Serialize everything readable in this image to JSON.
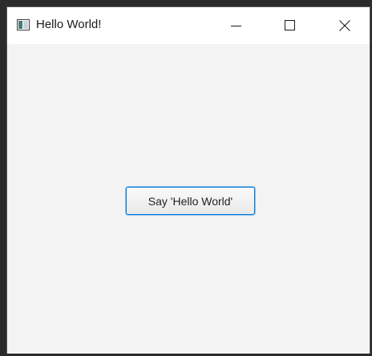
{
  "window": {
    "title": "Hello World!",
    "icon": "java-window-icon",
    "controls": [
      "minimize-icon",
      "maximize-icon",
      "close-icon"
    ]
  },
  "main": {
    "button_label": "Say 'Hello World'"
  },
  "colors": {
    "titlebar_bg": "#ffffff",
    "content_bg": "#f3f3f3",
    "button_focus_border": "#0078d7"
  }
}
